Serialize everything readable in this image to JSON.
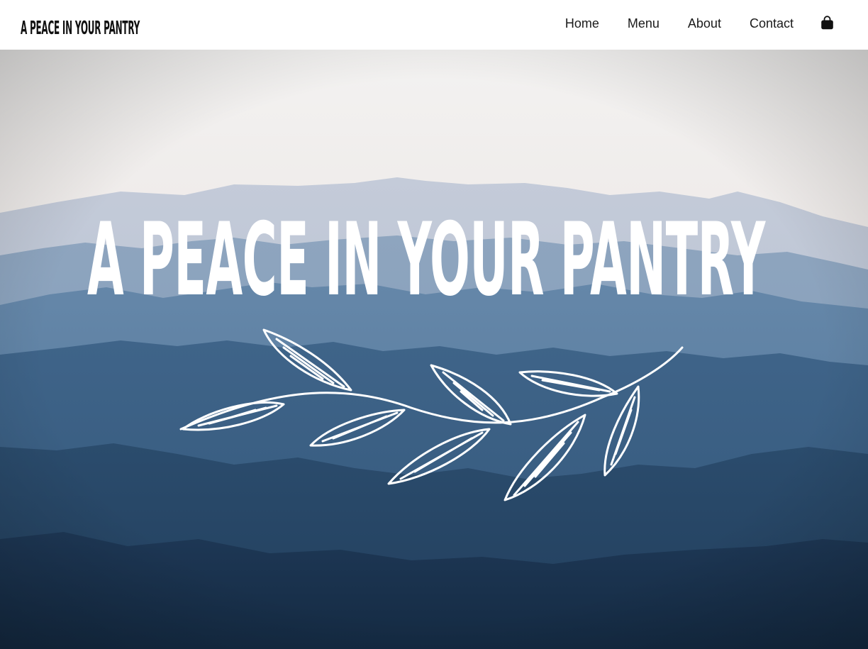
{
  "header": {
    "logo_text": "A PEACE IN YOUR PANTRY",
    "nav": [
      {
        "label": "Home"
      },
      {
        "label": "Menu"
      },
      {
        "label": "About"
      },
      {
        "label": "Contact"
      }
    ],
    "cart_icon": "shopping-bag-icon"
  },
  "hero": {
    "title": "A PEACE IN YOUR PANTRY",
    "ornament_icon": "leaf-branch-icon",
    "background": "misty blue mountain ridges under pale sky"
  },
  "colors": {
    "header_bg": "#ffffff",
    "nav_text": "#1a1a1a",
    "hero_text": "#ffffff",
    "sky_top": "#f2f1f0",
    "ridge_far": "#9fb3c8",
    "ridge_mid": "#4e7398",
    "ridge_near": "#1f3b59"
  }
}
